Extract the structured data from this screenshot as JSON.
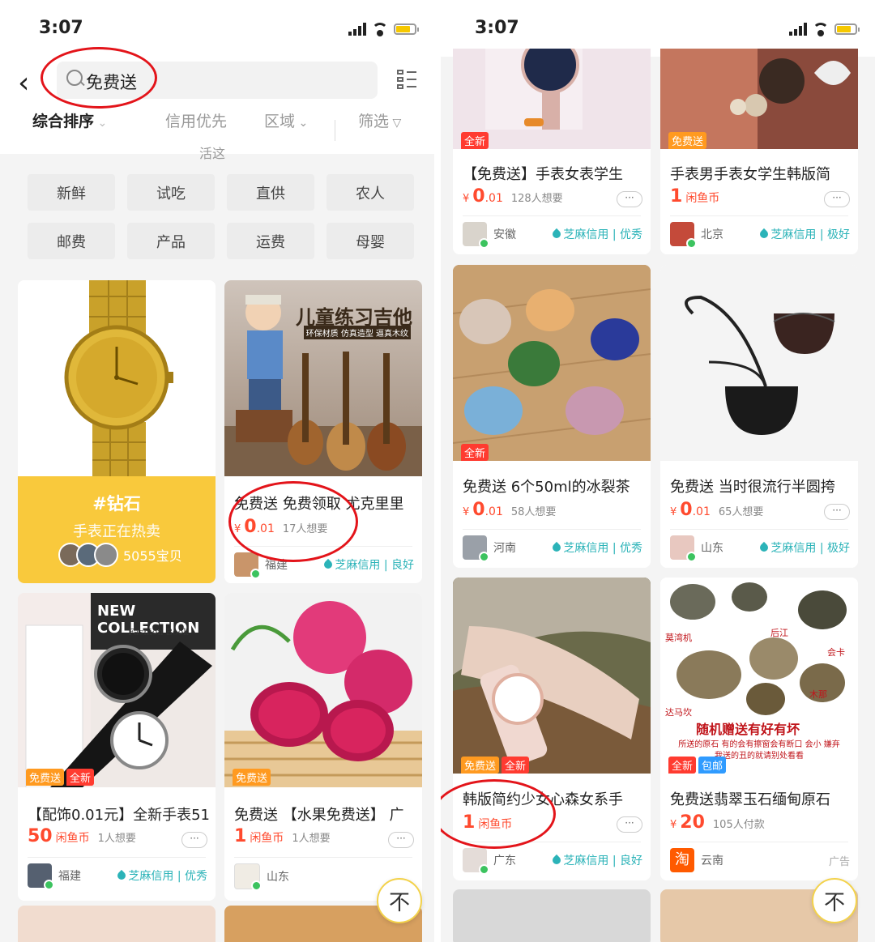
{
  "left": {
    "status": {
      "time": "3:07"
    },
    "search": {
      "query": "免费送"
    },
    "sort": {
      "comprehensive": "综合排序",
      "credit_first": "信用优先",
      "region": "区域",
      "filter": "筛选"
    },
    "hidden_title": "活这",
    "tags": [
      "新鲜",
      "试吃",
      "直供",
      "农人",
      "邮费",
      "产品",
      "运费",
      "母婴"
    ],
    "feature": {
      "hashtag": "#钻石",
      "subtitle": "手表正在热卖",
      "count": "5055宝贝"
    },
    "cards": [
      {
        "title": "免费送 免费领取 尤克里里",
        "price_symbol": "¥",
        "price_int": "0",
        "price_dec": ".01",
        "want": "17人想要",
        "location": "福建",
        "credit": "芝麻信用 | 良好",
        "image_text": "儿童练习吉他",
        "image_subtext": "环保材质 仿真造型 逼真木纹"
      },
      {
        "badges": [
          "免费送",
          "全新"
        ],
        "title": "【配饰0.01元】全新手表51",
        "price_int": "50",
        "price_unit": "闲鱼币",
        "want": "1人想要",
        "more": "···",
        "location": "福建",
        "credit": "芝麻信用 | 优秀",
        "image_text": "NEW COLLECTION",
        "image_subtext": "Fashion Book"
      },
      {
        "badges": [
          "免费送"
        ],
        "title": "免费送 【水果免费送】 广",
        "price_int": "1",
        "price_unit": "闲鱼币",
        "want": "1人想要",
        "more": "···",
        "location": "山东"
      }
    ],
    "to_top": "不"
  },
  "right": {
    "status": {
      "time": "3:07"
    },
    "cards": [
      {
        "badges": [
          "全新"
        ],
        "title": "【免费送】手表女表学生",
        "price_symbol": "¥",
        "price_int": "0",
        "price_dec": ".01",
        "want": "128人想要",
        "more": "···",
        "location": "安徽",
        "credit": "芝麻信用 | 优秀"
      },
      {
        "badges": [
          "免费送"
        ],
        "title": "手表男手表女学生韩版简",
        "price_int": "1",
        "price_unit": "闲鱼币",
        "more": "···",
        "location": "北京",
        "credit": "芝麻信用 | 极好"
      },
      {
        "badges": [
          "全新"
        ],
        "title": "免费送 6个50ml的冰裂茶",
        "price_symbol": "¥",
        "price_int": "0",
        "price_dec": ".01",
        "want": "58人想要",
        "location": "河南",
        "credit": "芝麻信用 | 优秀"
      },
      {
        "title": "免费送 当时很流行半圆挎",
        "price_symbol": "¥",
        "price_int": "0",
        "price_dec": ".01",
        "want": "65人想要",
        "more": "···",
        "location": "山东",
        "credit": "芝麻信用 | 极好"
      },
      {
        "badges": [
          "免费送",
          "全新"
        ],
        "title": "韩版简约少女心森女系手",
        "price_int": "1",
        "price_unit": "闲鱼币",
        "more": "···",
        "location": "广东",
        "credit": "芝麻信用 | 良好"
      },
      {
        "badges": [
          "全新",
          "包邮"
        ],
        "title": "免费送翡翠玉石缅甸原石",
        "price_symbol": "¥",
        "price_int": "20",
        "want": "105人付款",
        "location": "云南",
        "ad": "广告",
        "image_text": "随机赠送有好有坏",
        "image_labels": [
          "莫湾机",
          "后江",
          "会卡",
          "木那",
          "达马坎"
        ],
        "image_subtext": "所送的原石 有的会有擦窗会有断口 会小 嫌弃我送的丑的就请别处看看"
      }
    ],
    "to_top": "不"
  }
}
